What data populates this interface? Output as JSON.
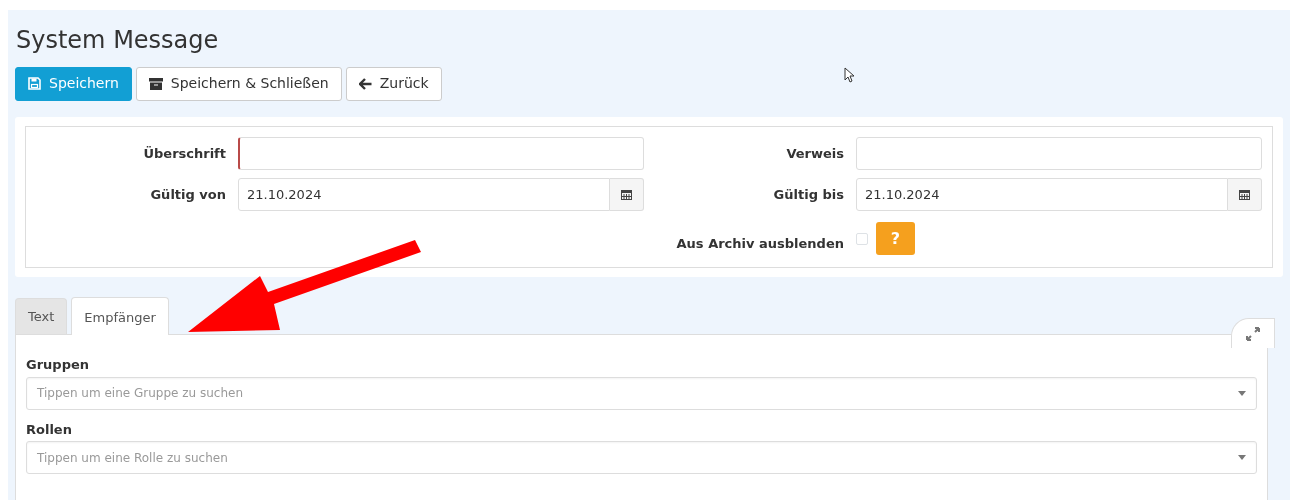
{
  "page": {
    "title": "System Message"
  },
  "toolbar": [
    {
      "label": "Speichern",
      "kind": "primary"
    },
    {
      "label": "Speichern & Schließen",
      "kind": "default"
    },
    {
      "label": "Zurück",
      "kind": "default"
    }
  ],
  "form": {
    "left": [
      {
        "label": "Überschrift",
        "kind": "text",
        "required": true
      },
      {
        "label": "Gültig von",
        "kind": "date",
        "value": "21.10.2024"
      }
    ],
    "right": [
      {
        "label": "Verweis",
        "kind": "text",
        "required": false
      },
      {
        "label": "Gültig bis",
        "kind": "date",
        "value": "21.10.2024"
      },
      {
        "label": "Aus Archiv ausblenden",
        "kind": "checkbox",
        "checked": false,
        "help": "?"
      }
    ]
  },
  "tabs": [
    {
      "label": "Text",
      "selected": false
    },
    {
      "label": "Empfänger",
      "selected": true
    }
  ],
  "recipients": [
    {
      "label": "Gruppen",
      "placeholder": "Tippen um eine Gruppe zu suchen"
    },
    {
      "label": "Rollen",
      "placeholder": "Tippen um eine Rolle zu suchen"
    }
  ]
}
